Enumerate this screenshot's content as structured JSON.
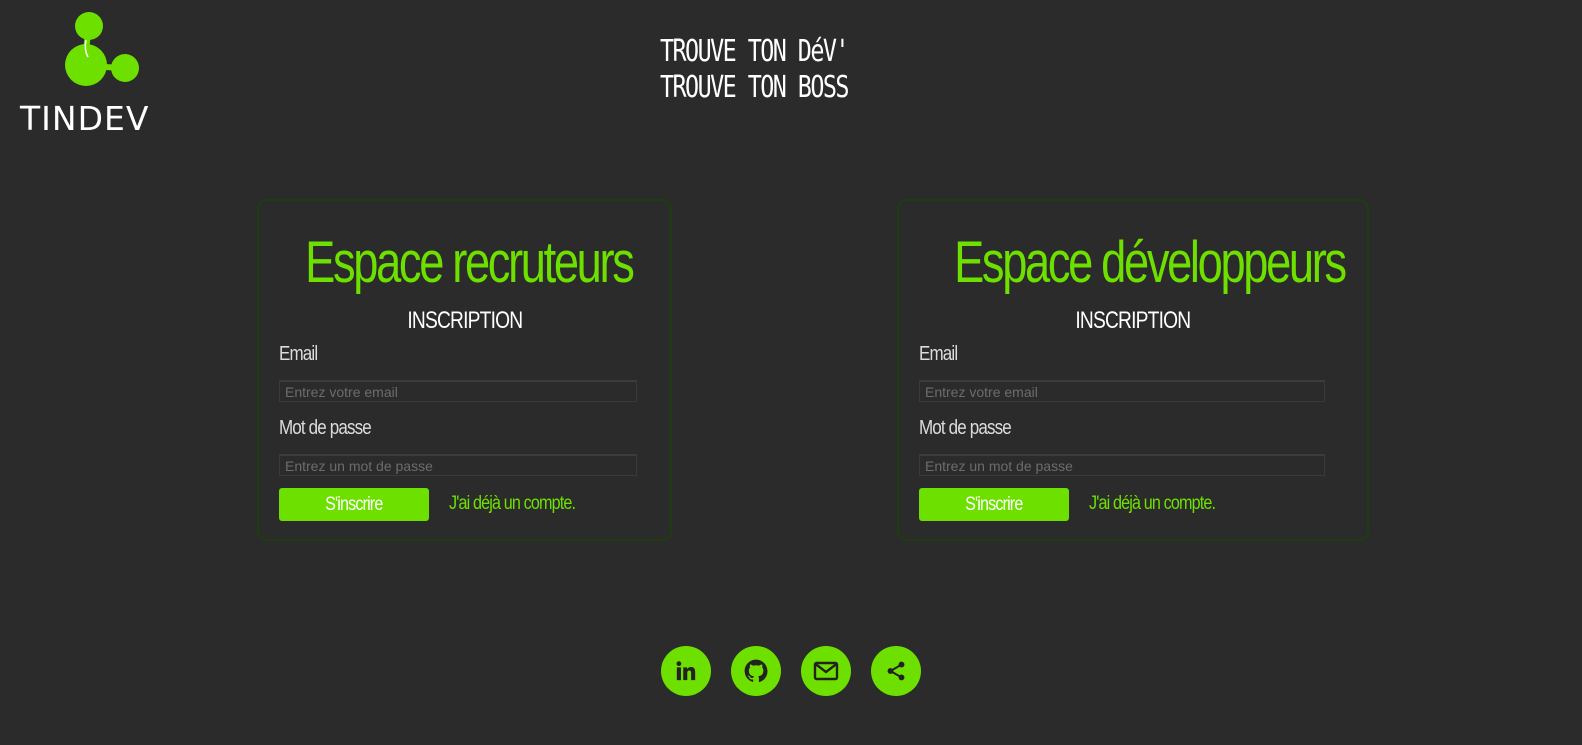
{
  "brand": {
    "name": "TINDEV",
    "accent_color": "#6ee000",
    "background_color": "#2b2b2b"
  },
  "header": {
    "tagline_line1": "TROUVE TON DéV'",
    "tagline_line2": "TROUVE TON BOSS"
  },
  "recruiter": {
    "title": "Espace recruteurs",
    "subtitle": "INSCRIPTION",
    "email_label": "Email",
    "email_placeholder": "Entrez votre email",
    "password_label": "Mot de passe",
    "password_placeholder": "Entrez un mot de passe",
    "signup_button": "S'inscrire",
    "login_link": "J'ai déjà un compte."
  },
  "developer": {
    "title": "Espace développeurs",
    "subtitle": "INSCRIPTION",
    "email_label": "Email",
    "email_placeholder": "Entrez votre email",
    "password_label": "Mot de passe",
    "password_placeholder": "Entrez un mot de passe",
    "signup_button": "S'inscrire",
    "login_link": "J'ai déjà un compte."
  },
  "footer": {
    "icons": [
      "linkedin-icon",
      "github-icon",
      "mail-icon",
      "share-icon"
    ]
  }
}
